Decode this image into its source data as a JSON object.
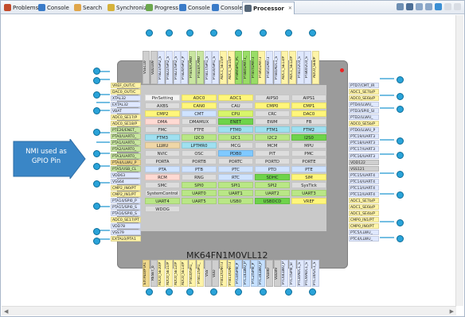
{
  "tabs": [
    {
      "label": "Problems",
      "icon": "problems-icon",
      "color": "#c24b2b"
    },
    {
      "label": "Console",
      "icon": "console-icon",
      "color": "#3a7bc8"
    },
    {
      "label": "Search",
      "icon": "search-icon",
      "color": "#e0a64a"
    },
    {
      "label": "Synchronize",
      "icon": "synchronize-icon",
      "color": "#d6b23a"
    },
    {
      "label": "Progress",
      "icon": "progress-icon",
      "color": "#6ca84e"
    },
    {
      "label": "Console",
      "icon": "console-icon",
      "color": "#3a7bc8"
    },
    {
      "label": "Console",
      "icon": "console-icon",
      "color": "#3a7bc8"
    },
    {
      "label": "Processor",
      "icon": "processor-icon",
      "color": "#556677",
      "active": true
    }
  ],
  "callout": {
    "line1": "NMI used as",
    "line2": "GPIO Pin",
    "color": "#3a86c6"
  },
  "chip": {
    "name": "MK64FN1M0VLL12"
  },
  "peripherals": [
    [
      "PinSetting|k-white",
      "ADC0|k-yellow",
      "ADC1|k-yellow",
      "AIPS0|k-gray",
      "AIPS1|k-gray"
    ],
    [
      "AXBS|k-gray",
      "CAN0|k-yellow",
      "CAU|k-gray",
      "CMP0|k-yellow",
      "CMP1|k-yellow"
    ],
    [
      "CMP2|k-yellow",
      "CMT|k-lblue",
      "CPU|k-lime",
      "CRC|k-gray",
      "DAC0|k-yellow"
    ],
    [
      "DMA|k-pink",
      "DMAMUX|k-gray",
      "ENET|k-green",
      "EWM|k-gray",
      "FB|k-gray"
    ],
    [
      "FMC|k-gray",
      "FTFE|k-gray",
      "FTM0|k-cyan",
      "FTM1|k-cyan",
      "FTM2|k-cyan"
    ],
    [
      "FTM3|k-cyan",
      "I2C0|k-lgreen",
      "I2C1|k-lgreen",
      "I2C2|k-lgreen",
      "I2S0|k-green"
    ],
    [
      "LLWU|k-tan",
      "LPTMR0|k-cyan",
      "MCG|k-gray",
      "MCM|k-gray",
      "MPU|k-gray"
    ],
    [
      "NVIC|k-gray",
      "OSC|k-gray",
      "PDB0|k-blue",
      "PIT|k-gray",
      "PMC|k-gray"
    ],
    [
      "PORTA|k-gray",
      "PORTB|k-gray",
      "PORTC|k-gray",
      "PORTD|k-gray",
      "PORTE|k-gray"
    ],
    [
      "PTA|k-lblue",
      "PTB|k-lblue",
      "PTC|k-lblue",
      "PTD|k-lblue",
      "PTE|k-lblue"
    ],
    [
      "RCM|k-pink",
      "RNG|k-gray",
      "RTC|k-lblue",
      "SDHC|k-green",
      "SIM|k-yellow"
    ],
    [
      "SMC|k-gray",
      "SPI0|k-lgreen",
      "SPI1|k-lgreen",
      "SPI2|k-lgreen",
      "SysTick|k-gray"
    ],
    [
      "SystemControl|k-gray",
      "UART0|k-lgreen",
      "UART1|k-lgreen",
      "UART2|k-lgreen",
      "UART3|k-lgreen"
    ],
    [
      "UART4|k-lgreen",
      "UART5|k-lgreen",
      "USB0|k-lgreen",
      "USBDCD|k-green",
      "VREF|k-yellow"
    ],
    [
      "WDOG|k-gray",
      "|blank",
      "|blank",
      "|blank",
      "|blank"
    ]
  ],
  "pins_left": [
    "VREF_OUT/C|c1",
    "DAC0_OUT/C|c1",
    "XTAL32|c0",
    "EXTAL32|c0",
    "VBAT|c0",
    "ADC0_SE17/P|c1",
    "ADC0_SE18/P|c1",
    "PTE26/ENET_|c2",
    "PTA0/UART0_|c2",
    "PTA1/UART0_|c2",
    "PTA2/UART0_|c2",
    "PTA3/UART0_|c2",
    "PTA4/LLWU_P|c4",
    "PTA5/USB_CL|c2",
    "VDD63|c0",
    "VSS64|c0",
    "CMP2_IN0/PT|c1",
    "CMP2_IN1/PT|c1",
    "PTA14/SPI0_P|c0",
    "PTA15/SPI0_S|c0",
    "PTA16/SPI0_S|c0",
    "ADC0_SE17/PT|c1",
    "VDD78|c0",
    "VSS79|c0",
    "EXTAL0/PTA1|c1"
  ],
  "pins_right": [
    "PTD7/CMT_IR|c0",
    "ADC1_SE7b/P|c1",
    "ADC0_SE6b/P|c1",
    "PTD4/LLWU_|c0",
    "PTD3/SPI0_SI|c0",
    "PTD2/LLWU_|c0",
    "ADC0_SE5b/P|c1",
    "PTD0/LLWU_P|c0",
    "PTC19/UART3|c0",
    "PTC18/UART3|c0",
    "PTC17/UART3|c0",
    "PTC16/UART3|c0",
    "VDD122|c6",
    "VSS121|c6",
    "PTC15/UART4|c0",
    "PTC14/UART4|c0",
    "PTC13/UART4|c0",
    "PTC12/UART4|c0",
    "ADC1_SE7b/P|c1",
    "ADC1_SE6b/P|c1",
    "ADC1_SE4b/P|c1",
    "CMP0_IN1/PT|c1",
    "CMP0_IN0/PT|c1",
    "PTC5/LLWU_|c0",
    "PTC4/LLWU_|c0"
  ],
  "pins_top": [
    "VSS110|c6",
    "VDD109|c6",
    "PTB23/SPI2_S|c0",
    "PTB22/SPI2_S|c0",
    "PTB21/SPI2_S|c0",
    "PTB20/SPI2_P|c0",
    "PTB19/CAN0|c2",
    "PTB18/CAN0|c2",
    "PTB17/SPI1_S|c0",
    "PTB16/SPI1_S|c0",
    "ADC1_SE15/P|c1",
    "ADC1_SE14/P|c1",
    "PTB9/SPI1_PC|c3",
    "PTB8/UART3_|c3",
    "PTB7/UART3|c3",
    "PTB6/UART3|c1",
    "PTB5/UART3|c0",
    "PTB4/ADC1_S|c0",
    "ADC1_SE13/P|c1",
    "ADC1_SE12/P|c1",
    "PTB1/I2C0_S|c0",
    "PTB0/I2C0_S|c0",
    "ADC0_SE8/P|c1"
  ],
  "pins_bottom": [
    "EXTAL0/PTA1|c4",
    "RESET_b|c6",
    "ADC0_SE10/P|c1",
    "ADC0_SE11/P|c1",
    "ADC0_SE12/P|c1",
    "ADC0_SE13/P|c1",
    "PTB10/SPI1_|c1",
    "PTB11/SPI1_|c1",
    "VSS|c6",
    "VDD|c6",
    "PTB12/UART3|c1",
    "PTB13/UART3|c1",
    "PTC0/SPI0_P|c5",
    "PTC1/LLWU_P|c5",
    "PTC2/SPI0_P|c5",
    "PTC3/LLWU_P|c5",
    "VSS90|c6",
    "VDD89|c6",
    "PTC6/LLWU_P|c0",
    "PTC7/SPI0_SI|c0",
    "PTC8/ADC1_S|c0",
    "PTC9/ADC1_S|c0",
    "PTC10/I2C1_S|c0"
  ]
}
